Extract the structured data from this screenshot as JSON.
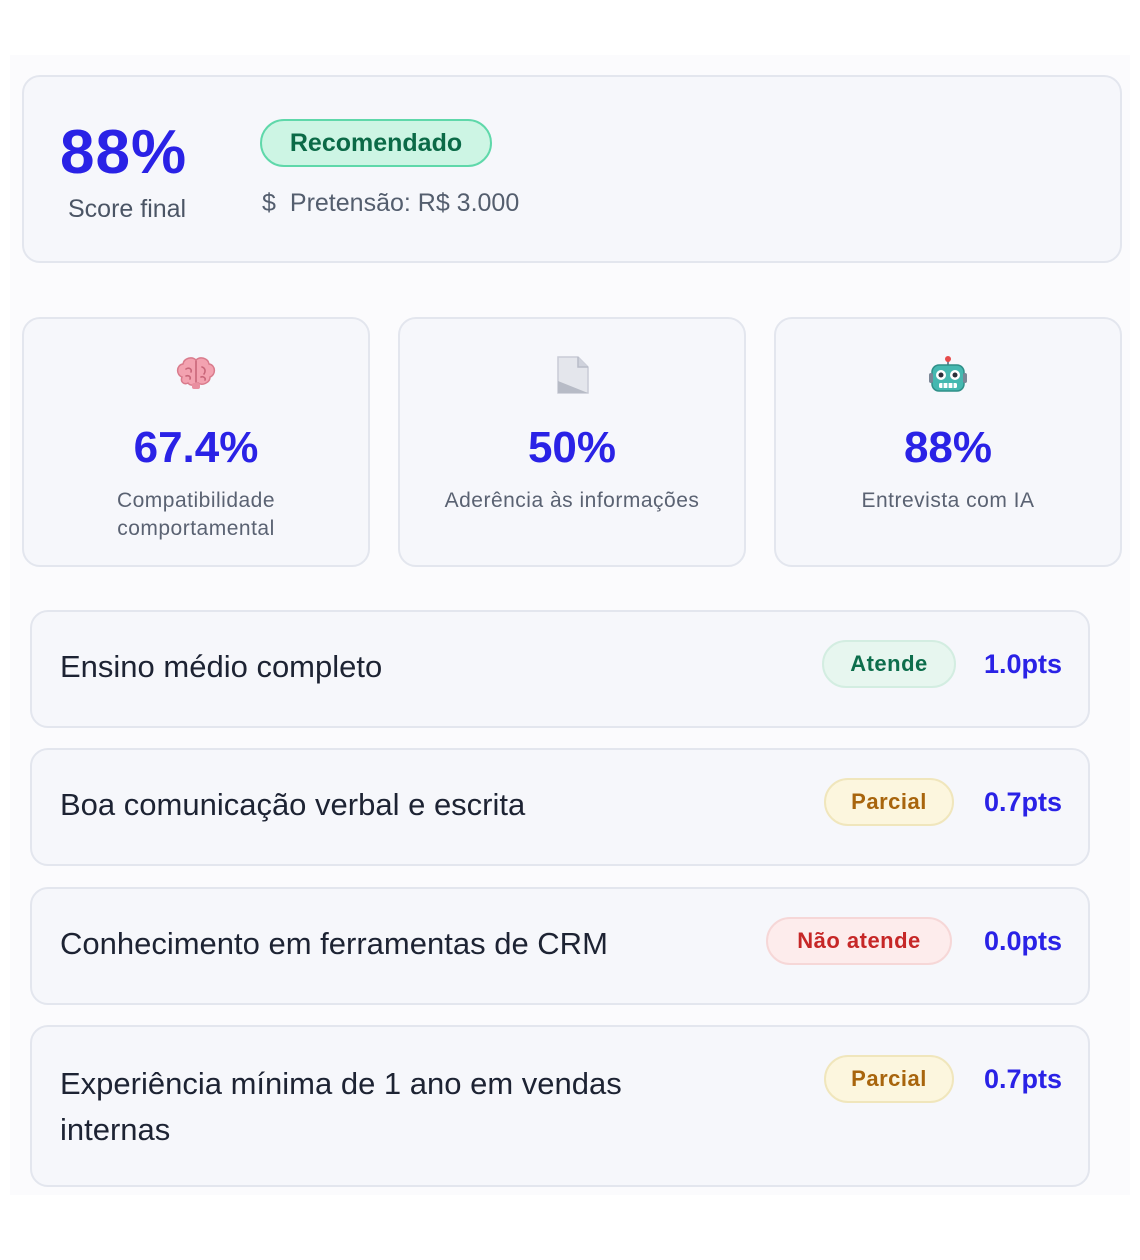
{
  "summary": {
    "score_value": "88%",
    "score_label": "Score final",
    "recommendation_badge": "Recomendado",
    "salary_icon": "dollar-icon",
    "salary_text": "Pretensão: R$ 3.000"
  },
  "metrics": [
    {
      "icon": "brain-icon",
      "value": "67.4%",
      "label": "Compatibilidade comportamental"
    },
    {
      "icon": "document-icon",
      "value": "50%",
      "label": "Aderência às informações"
    },
    {
      "icon": "robot-icon",
      "value": "88%",
      "label": "Entrevista com IA"
    }
  ],
  "requirements": [
    {
      "text": "Ensino médio completo",
      "status": "Atende",
      "points": "1.0pts"
    },
    {
      "text": "Boa comunicação verbal e escrita",
      "status": "Parcial",
      "points": "0.7pts"
    },
    {
      "text": "Conhecimento em ferramentas de CRM",
      "status": "Não atende",
      "points": "0.0pts"
    },
    {
      "text": "Experiência mínima de 1 ano em vendas internas",
      "status": "Parcial",
      "points": "0.7pts"
    }
  ],
  "colors": {
    "accent": "#2a22e6",
    "recommended_bg": "#cdf5e4",
    "status_ok": "#0d6e4c",
    "status_partial": "#a8650d",
    "status_no": "#c62727"
  }
}
